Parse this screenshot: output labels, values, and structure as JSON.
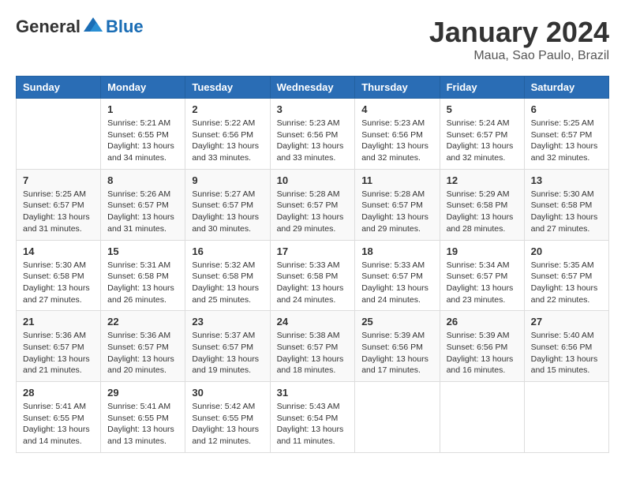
{
  "header": {
    "logo_general": "General",
    "logo_blue": "Blue",
    "title": "January 2024",
    "subtitle": "Maua, Sao Paulo, Brazil"
  },
  "columns": [
    "Sunday",
    "Monday",
    "Tuesday",
    "Wednesday",
    "Thursday",
    "Friday",
    "Saturday"
  ],
  "weeks": [
    [
      {
        "day": "",
        "info": ""
      },
      {
        "day": "1",
        "info": "Sunrise: 5:21 AM\nSunset: 6:55 PM\nDaylight: 13 hours\nand 34 minutes."
      },
      {
        "day": "2",
        "info": "Sunrise: 5:22 AM\nSunset: 6:56 PM\nDaylight: 13 hours\nand 33 minutes."
      },
      {
        "day": "3",
        "info": "Sunrise: 5:23 AM\nSunset: 6:56 PM\nDaylight: 13 hours\nand 33 minutes."
      },
      {
        "day": "4",
        "info": "Sunrise: 5:23 AM\nSunset: 6:56 PM\nDaylight: 13 hours\nand 32 minutes."
      },
      {
        "day": "5",
        "info": "Sunrise: 5:24 AM\nSunset: 6:57 PM\nDaylight: 13 hours\nand 32 minutes."
      },
      {
        "day": "6",
        "info": "Sunrise: 5:25 AM\nSunset: 6:57 PM\nDaylight: 13 hours\nand 32 minutes."
      }
    ],
    [
      {
        "day": "7",
        "info": "Sunrise: 5:25 AM\nSunset: 6:57 PM\nDaylight: 13 hours\nand 31 minutes."
      },
      {
        "day": "8",
        "info": "Sunrise: 5:26 AM\nSunset: 6:57 PM\nDaylight: 13 hours\nand 31 minutes."
      },
      {
        "day": "9",
        "info": "Sunrise: 5:27 AM\nSunset: 6:57 PM\nDaylight: 13 hours\nand 30 minutes."
      },
      {
        "day": "10",
        "info": "Sunrise: 5:28 AM\nSunset: 6:57 PM\nDaylight: 13 hours\nand 29 minutes."
      },
      {
        "day": "11",
        "info": "Sunrise: 5:28 AM\nSunset: 6:57 PM\nDaylight: 13 hours\nand 29 minutes."
      },
      {
        "day": "12",
        "info": "Sunrise: 5:29 AM\nSunset: 6:58 PM\nDaylight: 13 hours\nand 28 minutes."
      },
      {
        "day": "13",
        "info": "Sunrise: 5:30 AM\nSunset: 6:58 PM\nDaylight: 13 hours\nand 27 minutes."
      }
    ],
    [
      {
        "day": "14",
        "info": "Sunrise: 5:30 AM\nSunset: 6:58 PM\nDaylight: 13 hours\nand 27 minutes."
      },
      {
        "day": "15",
        "info": "Sunrise: 5:31 AM\nSunset: 6:58 PM\nDaylight: 13 hours\nand 26 minutes."
      },
      {
        "day": "16",
        "info": "Sunrise: 5:32 AM\nSunset: 6:58 PM\nDaylight: 13 hours\nand 25 minutes."
      },
      {
        "day": "17",
        "info": "Sunrise: 5:33 AM\nSunset: 6:58 PM\nDaylight: 13 hours\nand 24 minutes."
      },
      {
        "day": "18",
        "info": "Sunrise: 5:33 AM\nSunset: 6:57 PM\nDaylight: 13 hours\nand 24 minutes."
      },
      {
        "day": "19",
        "info": "Sunrise: 5:34 AM\nSunset: 6:57 PM\nDaylight: 13 hours\nand 23 minutes."
      },
      {
        "day": "20",
        "info": "Sunrise: 5:35 AM\nSunset: 6:57 PM\nDaylight: 13 hours\nand 22 minutes."
      }
    ],
    [
      {
        "day": "21",
        "info": "Sunrise: 5:36 AM\nSunset: 6:57 PM\nDaylight: 13 hours\nand 21 minutes."
      },
      {
        "day": "22",
        "info": "Sunrise: 5:36 AM\nSunset: 6:57 PM\nDaylight: 13 hours\nand 20 minutes."
      },
      {
        "day": "23",
        "info": "Sunrise: 5:37 AM\nSunset: 6:57 PM\nDaylight: 13 hours\nand 19 minutes."
      },
      {
        "day": "24",
        "info": "Sunrise: 5:38 AM\nSunset: 6:57 PM\nDaylight: 13 hours\nand 18 minutes."
      },
      {
        "day": "25",
        "info": "Sunrise: 5:39 AM\nSunset: 6:56 PM\nDaylight: 13 hours\nand 17 minutes."
      },
      {
        "day": "26",
        "info": "Sunrise: 5:39 AM\nSunset: 6:56 PM\nDaylight: 13 hours\nand 16 minutes."
      },
      {
        "day": "27",
        "info": "Sunrise: 5:40 AM\nSunset: 6:56 PM\nDaylight: 13 hours\nand 15 minutes."
      }
    ],
    [
      {
        "day": "28",
        "info": "Sunrise: 5:41 AM\nSunset: 6:55 PM\nDaylight: 13 hours\nand 14 minutes."
      },
      {
        "day": "29",
        "info": "Sunrise: 5:41 AM\nSunset: 6:55 PM\nDaylight: 13 hours\nand 13 minutes."
      },
      {
        "day": "30",
        "info": "Sunrise: 5:42 AM\nSunset: 6:55 PM\nDaylight: 13 hours\nand 12 minutes."
      },
      {
        "day": "31",
        "info": "Sunrise: 5:43 AM\nSunset: 6:54 PM\nDaylight: 13 hours\nand 11 minutes."
      },
      {
        "day": "",
        "info": ""
      },
      {
        "day": "",
        "info": ""
      },
      {
        "day": "",
        "info": ""
      }
    ]
  ]
}
